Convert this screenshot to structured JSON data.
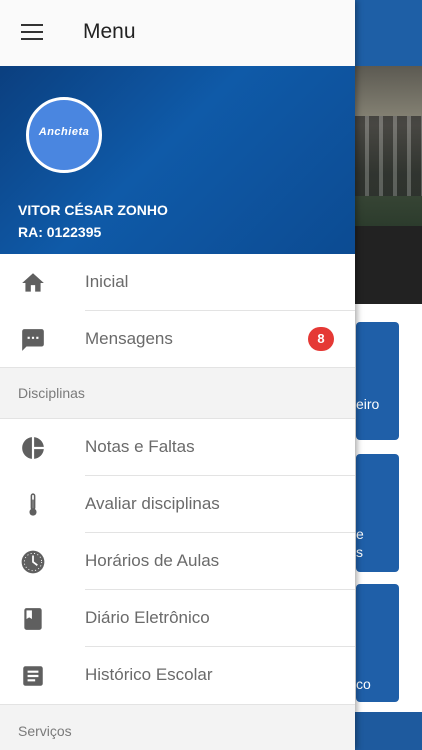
{
  "header": {
    "title": "Menu"
  },
  "profile": {
    "logo_text": "Anchieta",
    "name": "VITOR CÉSAR ZONHO",
    "ra": "RA: 0122395"
  },
  "menu": {
    "home": "Inicial",
    "messages": "Mensagens",
    "messages_badge": "8"
  },
  "sections": {
    "disciplinas": "Disciplinas",
    "servicos": "Serviços"
  },
  "disciplinas": {
    "notas": "Notas e Faltas",
    "avaliar": "Avaliar disciplinas",
    "horarios": "Horários de Aulas",
    "diario": "Diário Eletrônico",
    "historico": "Histórico Escolar"
  },
  "background": {
    "tile1_text": "eiro",
    "tile2_text_a": "e",
    "tile2_text_b": "s",
    "tile3_text": "co"
  },
  "colors": {
    "brand": "#0f5aa8",
    "badge": "#e53935"
  }
}
